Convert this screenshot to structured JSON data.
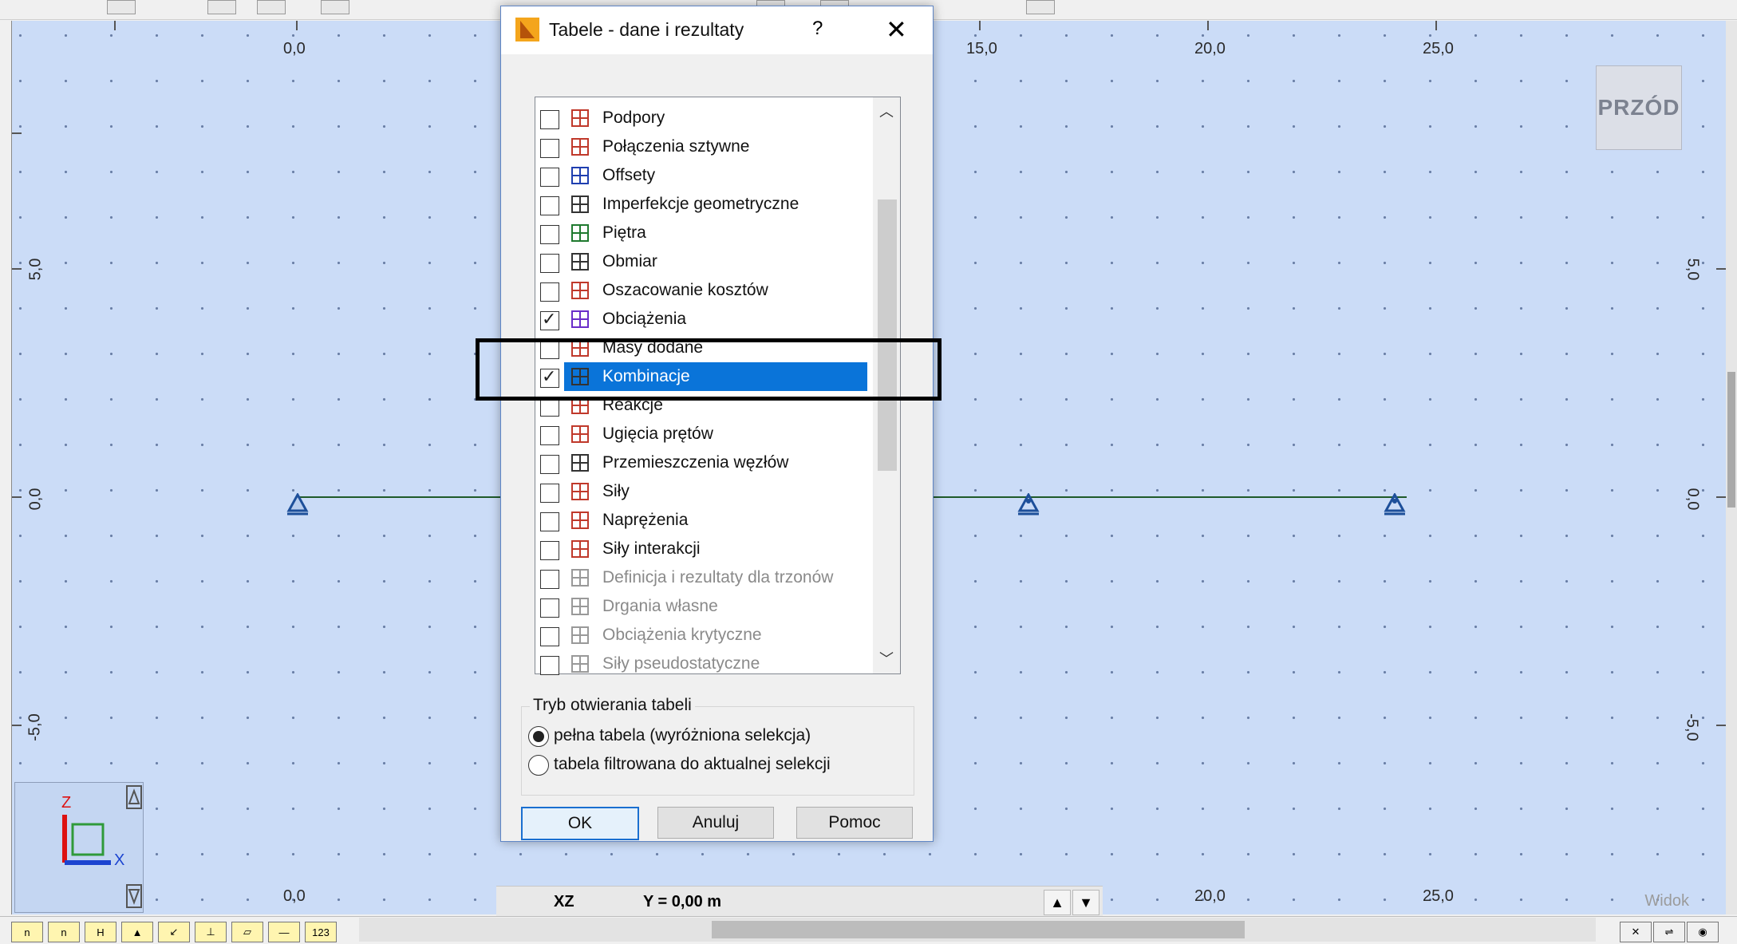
{
  "canvas": {
    "x_top": [
      "0,0",
      "15,0",
      "20,0",
      "25,0"
    ],
    "x_bottom": [
      "0,0",
      "20,0",
      "25,0"
    ],
    "y_left": [
      "5,0",
      "0,0",
      "-5,0"
    ],
    "y_right": [
      "5,0",
      "0,0",
      "-5,0"
    ],
    "view_label": "PRZÓD",
    "axis_z": "Z",
    "axis_x": "X"
  },
  "statusbar": {
    "plane": "XZ",
    "coord": "Y = 0,00 m",
    "view": "Widok",
    "up_arrow": "▲",
    "down_arrow": "▼"
  },
  "dialog": {
    "title": "Tabele - dane i rezultaty",
    "help": "?",
    "close": "✕",
    "items": [
      {
        "label": "Podpory",
        "checked": false,
        "enabled": true
      },
      {
        "label": "Połączenia sztywne",
        "checked": false,
        "enabled": true
      },
      {
        "label": "Offsety",
        "checked": false,
        "enabled": true
      },
      {
        "label": "Imperfekcje geometryczne",
        "checked": false,
        "enabled": true
      },
      {
        "label": "Piętra",
        "checked": false,
        "enabled": true
      },
      {
        "label": "Obmiar",
        "checked": false,
        "enabled": true
      },
      {
        "label": "Oszacowanie kosztów",
        "checked": false,
        "enabled": true
      },
      {
        "label": "Obciążenia",
        "checked": true,
        "enabled": true
      },
      {
        "label": "Masy dodane",
        "checked": false,
        "enabled": true
      },
      {
        "label": "Kombinacje",
        "checked": true,
        "enabled": true,
        "selected": true
      },
      {
        "label": "Reakcje",
        "checked": false,
        "enabled": true
      },
      {
        "label": "Ugięcia prętów",
        "checked": false,
        "enabled": true
      },
      {
        "label": "Przemieszczenia węzłów",
        "checked": false,
        "enabled": true
      },
      {
        "label": "Siły",
        "checked": false,
        "enabled": true
      },
      {
        "label": "Naprężenia",
        "checked": false,
        "enabled": true
      },
      {
        "label": "Siły interakcji",
        "checked": false,
        "enabled": true
      },
      {
        "label": "Definicja i rezultaty dla trzonów",
        "checked": false,
        "enabled": false
      },
      {
        "label": "Drgania własne",
        "checked": false,
        "enabled": false
      },
      {
        "label": "Obciążenia krytyczne",
        "checked": false,
        "enabled": false
      },
      {
        "label": "Siły pseudostatyczne",
        "checked": false,
        "enabled": false
      }
    ],
    "mode_group": "Tryb otwierania tabeli",
    "mode_full": "pełna tabela (wyróżniona selekcja)",
    "mode_filtered": "tabela filtrowana do aktualnej selekcji",
    "ok": "OK",
    "cancel": "Anuluj",
    "help_btn": "Pomoc"
  },
  "colors": {
    "canvas": "#cbdcf7",
    "selection": "#0a74d9",
    "callout": "#000000"
  }
}
